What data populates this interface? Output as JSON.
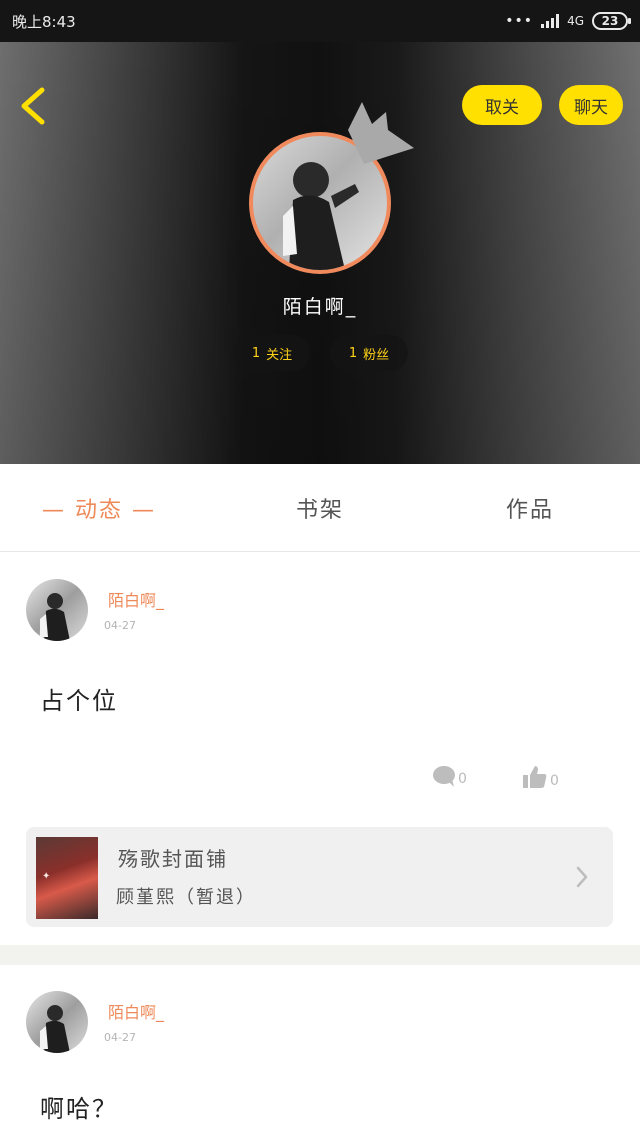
{
  "status_bar": {
    "time": "晚上8:43",
    "network": "4G",
    "battery": "23"
  },
  "profile": {
    "unfollow_label": "取关",
    "chat_label": "聊天",
    "nickname": "陌白啊_",
    "follow_count": "1",
    "follow_label": "关注",
    "fans_count": "1",
    "fans_label": "粉丝"
  },
  "tabs": [
    {
      "label": "— 动态 —",
      "active": true
    },
    {
      "label": "书架",
      "active": false
    },
    {
      "label": "作品",
      "active": false
    }
  ],
  "posts": [
    {
      "author": "陌白啊_",
      "date": "04-27",
      "text": "占个位",
      "comments": "0",
      "likes": "0",
      "book": {
        "title": "殇歌封面铺",
        "author": "顾堇熙（暂退）"
      }
    },
    {
      "author": "陌白啊_",
      "date": "04-27",
      "text": "啊哈？"
    }
  ],
  "colors": {
    "accent": "#ee8a5a",
    "button_yellow": "#ffe000",
    "stat_text": "#ffd21a"
  }
}
